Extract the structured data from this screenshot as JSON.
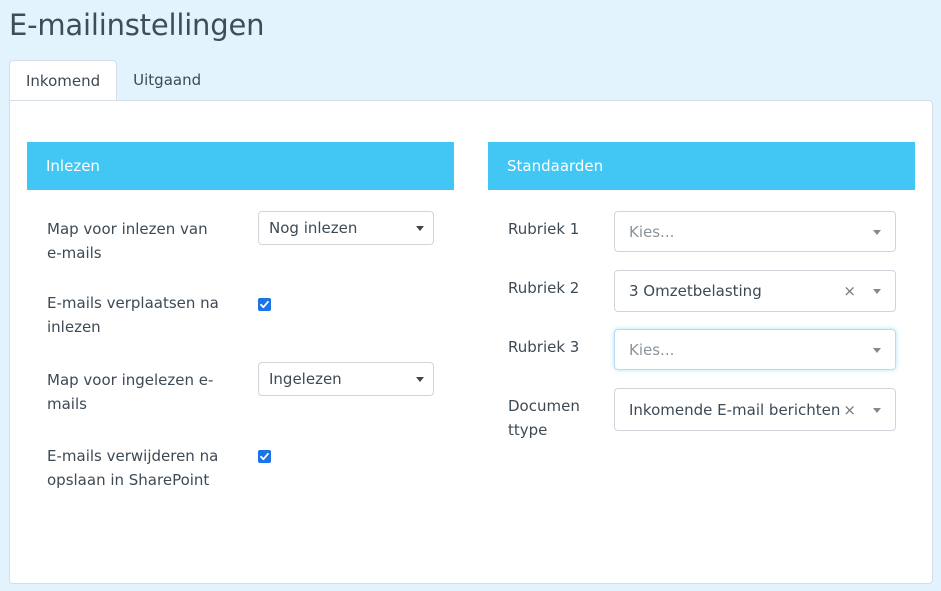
{
  "page": {
    "title": "E-mailinstellingen"
  },
  "tabs": [
    {
      "label": "Inkomend",
      "active": true
    },
    {
      "label": "Uitgaand",
      "active": false
    }
  ],
  "colors": {
    "accent": "#42c6f4",
    "checkbox": "#1a73e8",
    "background": "#e3f3fd"
  },
  "inlezen": {
    "header": "Inlezen",
    "map_inlezen": {
      "label_l1": "Map voor inlezen van",
      "label_l2": "e-mails",
      "value": "Nog inlezen"
    },
    "verplaatsen": {
      "label_l1": "E-mails verplaatsen na",
      "label_l2": "inlezen",
      "checked": true
    },
    "map_ingelezen": {
      "label_l1": "Map voor ingelezen e-",
      "label_l2": "mails",
      "value": "Ingelezen"
    },
    "verwijderen": {
      "label_l1": "E-mails verwijderen na",
      "label_l2": "opslaan in SharePoint",
      "checked": true
    }
  },
  "standaarden": {
    "header": "Standaarden",
    "rubriek1": {
      "label": "Rubriek 1",
      "placeholder": "Kies..."
    },
    "rubriek2": {
      "label": "Rubriek 2",
      "value": "3 Omzetbelasting",
      "clear": "×"
    },
    "rubriek3": {
      "label": "Rubriek 3",
      "placeholder": "Kies..."
    },
    "documenttype": {
      "label_l1": "Documen",
      "label_l2": "ttype",
      "value": "Inkomende E-mail berichten",
      "clear": "×"
    }
  }
}
